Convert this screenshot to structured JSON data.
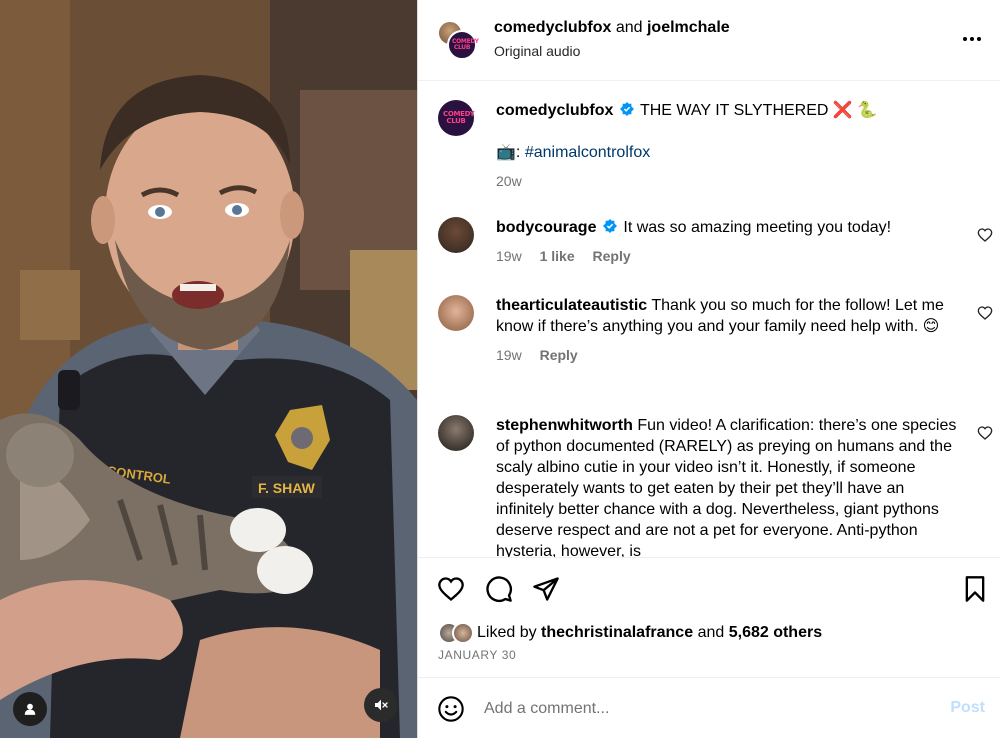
{
  "header": {
    "account1": "comedyclubfox",
    "conjunction": "and",
    "account2": "joelmchale",
    "audio": "Original audio",
    "logo_text": "COMEDY CLUB"
  },
  "caption": {
    "username": "comedyclubfox",
    "text": "THE WAY IT SLYTHERED ❌ 🐍",
    "tv_emoji": "📺:",
    "hashtag": "#animalcontrolfox",
    "time": "20w"
  },
  "comments": [
    {
      "username": "bodycourage",
      "verified": true,
      "text": "It was so amazing meeting you today!",
      "time": "19w",
      "likes": "1 like",
      "reply": "Reply"
    },
    {
      "username": "thearticulateautistic",
      "verified": false,
      "text": "Thank you so much for the follow! Let me know if there’s anything you and your family need help with. 😊",
      "time": "19w",
      "reply": "Reply"
    },
    {
      "username": "stephenwhitworth",
      "verified": false,
      "text": "Fun video! A clarification: there’s one species of python documented (RARELY) as preying on humans and the scaly albino cutie in your video isn’t it. Honestly, if someone desperately wants to get eaten by their pet they’ll have an infinitely better chance with a dog. Nevertheless, giant pythons deserve respect and are not a pet for everyone. Anti-python hysteria, however, is"
    }
  ],
  "likes": {
    "prefix": "Liked by",
    "user": "thechristinalafrance",
    "middle": "and",
    "others": "5,682 others"
  },
  "date": "JANUARY 30",
  "comment_box": {
    "placeholder": "Add a comment...",
    "post_label": "Post"
  },
  "media": {
    "badge_text": "F. SHAW",
    "patch_text": "AL CONTROL"
  },
  "colors": {
    "link": "#00376b",
    "verified": "#0095f6",
    "post_disabled": "#c0dffd",
    "muted": "#737373"
  }
}
